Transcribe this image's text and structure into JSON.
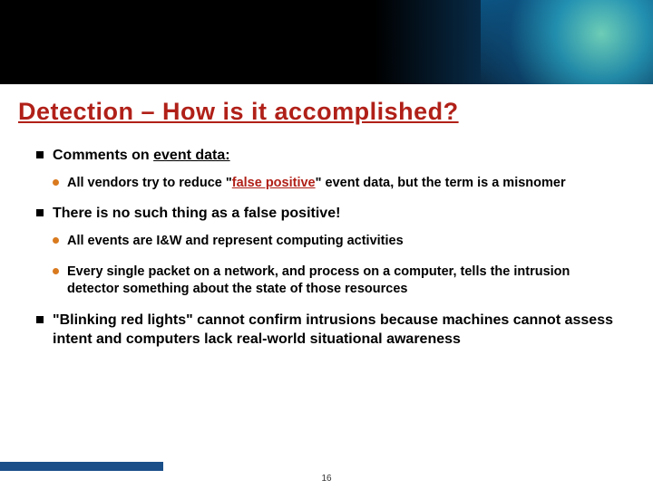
{
  "title": "Detection – How is it accomplished?",
  "bullets": {
    "b1": "Comments on ",
    "b1u": "event data:",
    "b1a_pre": "All vendors try to reduce \"",
    "b1a_mid": "false positive",
    "b1a_post": "\" event data, but the term is a misnomer",
    "b2": "There is no such thing as a false positive!",
    "b2a": "All events are I&W and represent computing activities",
    "b2b": "Every single packet on a network, and process on a computer, tells the intrusion detector something about the state of those resources",
    "b3": "\"Blinking red lights\" cannot confirm intrusions because machines cannot assess intent and computers lack real-world situational awareness"
  },
  "page_number": "16"
}
